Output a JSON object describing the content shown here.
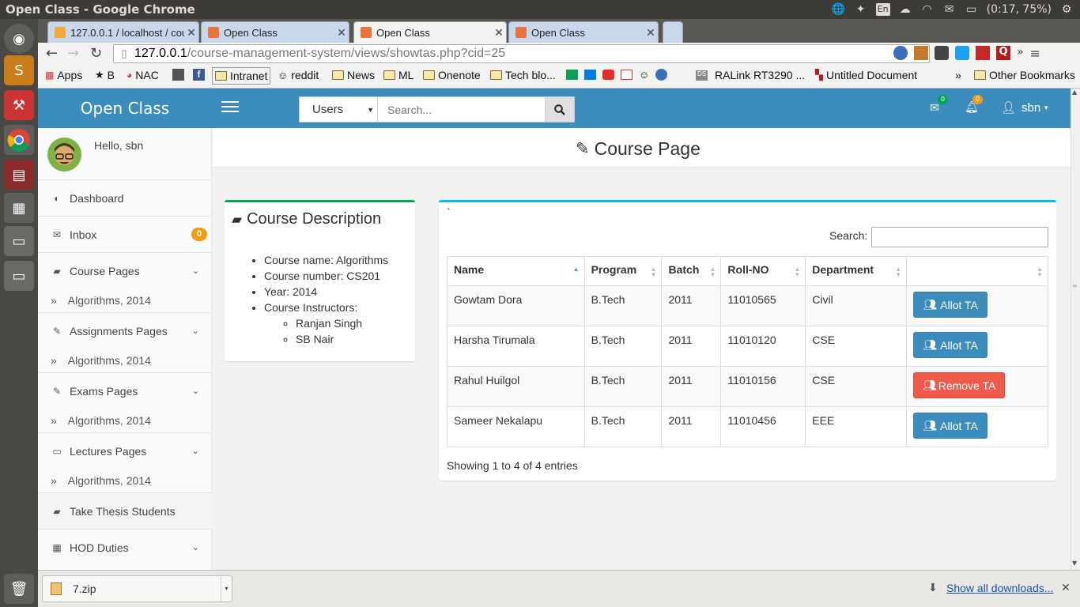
{
  "os": {
    "window_title": "Open Class - Google Chrome",
    "lang": "En",
    "battery": "(0:17, 75%)"
  },
  "browser": {
    "tabs": [
      {
        "label": "127.0.0.1 / localhost / cou"
      },
      {
        "label": "Open Class"
      },
      {
        "label": "Open Class"
      },
      {
        "label": "Open Class"
      }
    ],
    "url_host": "127.0.0.1",
    "url_path": "/course-management-system/views/showtas.php?cid=25",
    "bookmarks": [
      "Apps",
      "B",
      "NAC",
      "",
      "",
      "Intranet",
      "reddit",
      "News",
      "ML",
      "Onenote",
      "Tech blo...",
      "",
      "",
      "",
      "",
      "",
      "",
      "RALink RT3290 ...",
      "Untitled Document"
    ],
    "bookmarks_overflow": "»",
    "other_bookmarks": "Other Bookmarks"
  },
  "app": {
    "brand": "Open Class",
    "search_select": "Users",
    "search_placeholder": "Search...",
    "mail_count": "0",
    "notif_count": "0",
    "user": "sbn"
  },
  "sidebar": {
    "greeting": "Hello, sbn",
    "items": [
      {
        "label": "Dashboard"
      },
      {
        "label": "Inbox",
        "badge": "0"
      },
      {
        "label": "Course Pages",
        "sub": "Algorithms, 2014"
      },
      {
        "label": "Assignments Pages",
        "sub": "Algorithms, 2014"
      },
      {
        "label": "Exams Pages",
        "sub": "Algorithms, 2014"
      },
      {
        "label": "Lectures Pages",
        "sub": "Algorithms, 2014"
      },
      {
        "label": "Take Thesis Students"
      },
      {
        "label": "HOD Duties"
      }
    ]
  },
  "page": {
    "title": "Course Page"
  },
  "description": {
    "title": "Course Description",
    "lines": [
      "Course name: Algorithms",
      "Course number: CS201",
      "Year: 2014",
      "Course Instructors:"
    ],
    "instructors": [
      "Ranjan Singh",
      "SB Nair"
    ]
  },
  "table": {
    "tick": "`",
    "search_label": "Search:",
    "headers": [
      "Name",
      "Program",
      "Batch",
      "Roll-NO",
      "Department",
      ""
    ],
    "rows": [
      {
        "cells": [
          "Gowtam Dora",
          "B.Tech",
          "2011",
          "11010565",
          "Civil"
        ],
        "action": "Allot TA"
      },
      {
        "cells": [
          "Harsha Tirumala",
          "B.Tech",
          "2011",
          "11010120",
          "CSE"
        ],
        "action": "Allot TA"
      },
      {
        "cells": [
          "Rahul Huilgol",
          "B.Tech",
          "2011",
          "11010156",
          "CSE"
        ],
        "action": "Remove TA"
      },
      {
        "cells": [
          "Sameer Nekalapu",
          "B.Tech",
          "2011",
          "11010456",
          "EEE"
        ],
        "action": "Allot TA"
      }
    ],
    "info": "Showing 1 to 4 of 4 entries"
  },
  "downloads": {
    "file": "7.zip",
    "show_all": "Show all downloads..."
  }
}
